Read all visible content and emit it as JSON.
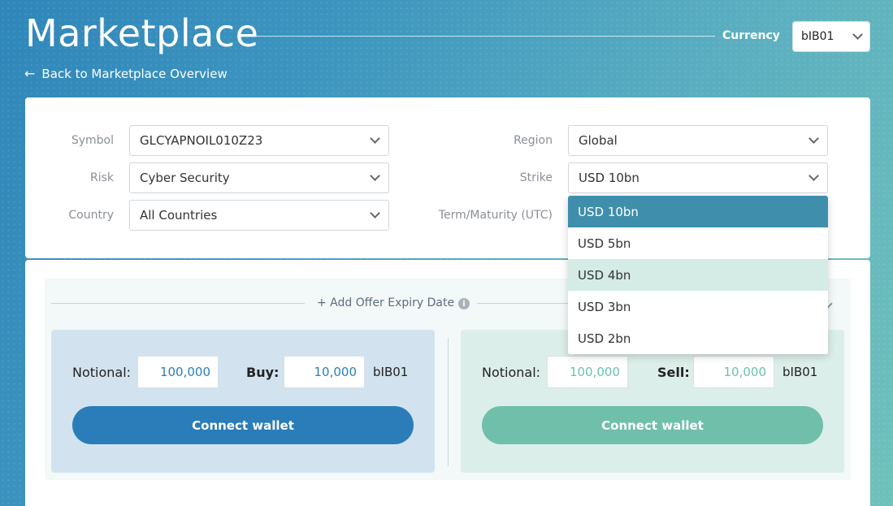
{
  "header": {
    "title": "Marketplace",
    "currency_label": "Currency",
    "currency_value": "bIB01",
    "back_link": "Back to Marketplace Overview"
  },
  "filters": {
    "symbol": {
      "label": "Symbol",
      "value": "GLCYAPNOIL010Z23"
    },
    "risk": {
      "label": "Risk",
      "value": "Cyber Security"
    },
    "country": {
      "label": "Country",
      "value": "All Countries"
    },
    "region": {
      "label": "Region",
      "value": "Global"
    },
    "strike": {
      "label": "Strike",
      "value": "USD 10bn"
    },
    "term": {
      "label": "Term/Maturity (UTC)"
    }
  },
  "strike_dropdown": {
    "options": [
      "USD 10bn",
      "USD 5bn",
      "USD 4bn",
      "USD 3bn",
      "USD 2bn"
    ],
    "selected": "USD 10bn",
    "hovered": "USD 4bn"
  },
  "offer": {
    "add_expiry": "+ Add Offer Expiry Date",
    "info_icon": "i"
  },
  "buy": {
    "notional_label": "Notional:",
    "notional_value": "100,000",
    "action_label": "Buy:",
    "action_value": "10,000",
    "unit": "bIB01",
    "button": "Connect wallet"
  },
  "sell": {
    "notional_label": "Notional:",
    "notional_value": "100,000",
    "action_label": "Sell:",
    "action_value": "10,000",
    "unit": "bIB01",
    "button": "Connect wallet"
  },
  "colors": {
    "accent_blue": "#2a7db8",
    "accent_teal": "#70bfab",
    "dropdown_selected": "#3f8fac",
    "dropdown_hover": "#d4ebe6"
  }
}
